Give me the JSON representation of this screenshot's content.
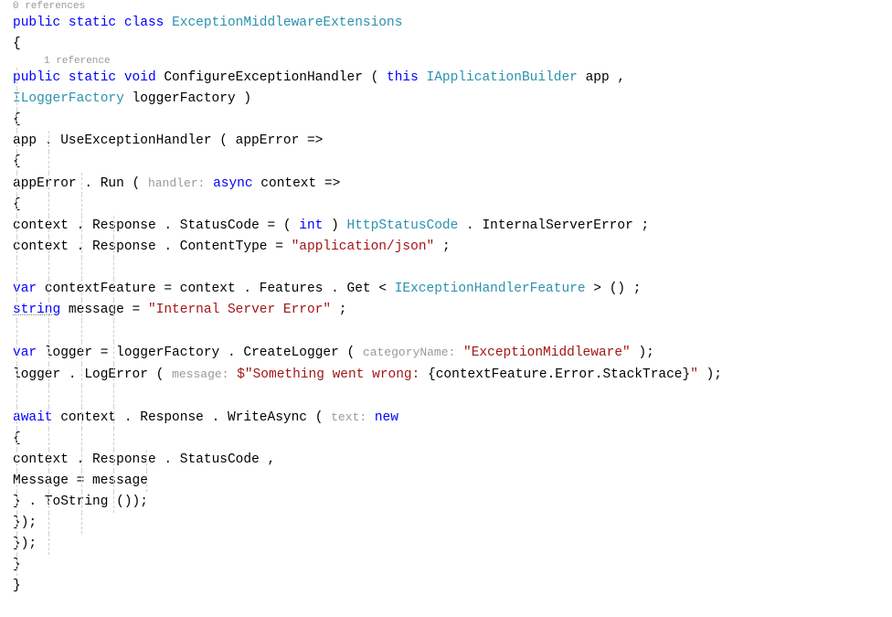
{
  "codelens": {
    "class_refs": "0 references",
    "method_refs": "1 reference"
  },
  "keywords": {
    "public": "public",
    "static": "static",
    "class": "class",
    "void": "void",
    "this": "this",
    "async": "async",
    "int": "int",
    "var": "var",
    "string": "string",
    "await": "await",
    "new": "new"
  },
  "types": {
    "class_name": "ExceptionMiddlewareExtensions",
    "iapp_builder": "IApplicationBuilder",
    "ilogger_factory": "ILoggerFactory",
    "http_status_code": "HttpStatusCode",
    "iexception_handler": "IExceptionHandlerFeature"
  },
  "identifiers": {
    "method_name": "ConfigureExceptionHandler",
    "app": "app",
    "logger_factory_param": "loggerFactory",
    "use_exc_handler": "UseExceptionHandler",
    "app_error": "appError",
    "run": "Run",
    "context": "context",
    "response": "Response",
    "status_code": "StatusCode",
    "internal_server_error": "InternalServerError",
    "content_type": "ContentType",
    "context_feature": "contextFeature",
    "features": "Features",
    "get": "Get",
    "message": "message",
    "logger": "logger",
    "create_logger": "CreateLogger",
    "log_error": "LogError",
    "write_async": "WriteAsync",
    "message_prop": "Message",
    "to_string": "ToString",
    "error": "Error",
    "stack_trace": "StackTrace"
  },
  "hints": {
    "handler": "handler:",
    "category_name": "categoryName:",
    "message_hint": "message:",
    "text": "text:"
  },
  "strings": {
    "app_json": "\"application/json\"",
    "internal_error": "\"Internal Server Error\"",
    "exception_mw": "\"ExceptionMiddleware\"",
    "something_wrong_prefix": "$\"Something went wrong: ",
    "interp_open": "{",
    "interp_close": "}",
    "string_close": "\""
  },
  "punct": {
    "open_brace": "{",
    "close_brace": "}",
    "open_paren": "(",
    "close_paren": ")",
    "semicolon": ";",
    "comma": ",",
    "dot": ".",
    "arrow": "=>",
    "assign": "=",
    "lt": "<",
    "gt": ">",
    "close_paren_semi": ");",
    "close_brace_paren_semi": "});",
    "paren_paren_semi": "());",
    "empty_parens": "()"
  }
}
